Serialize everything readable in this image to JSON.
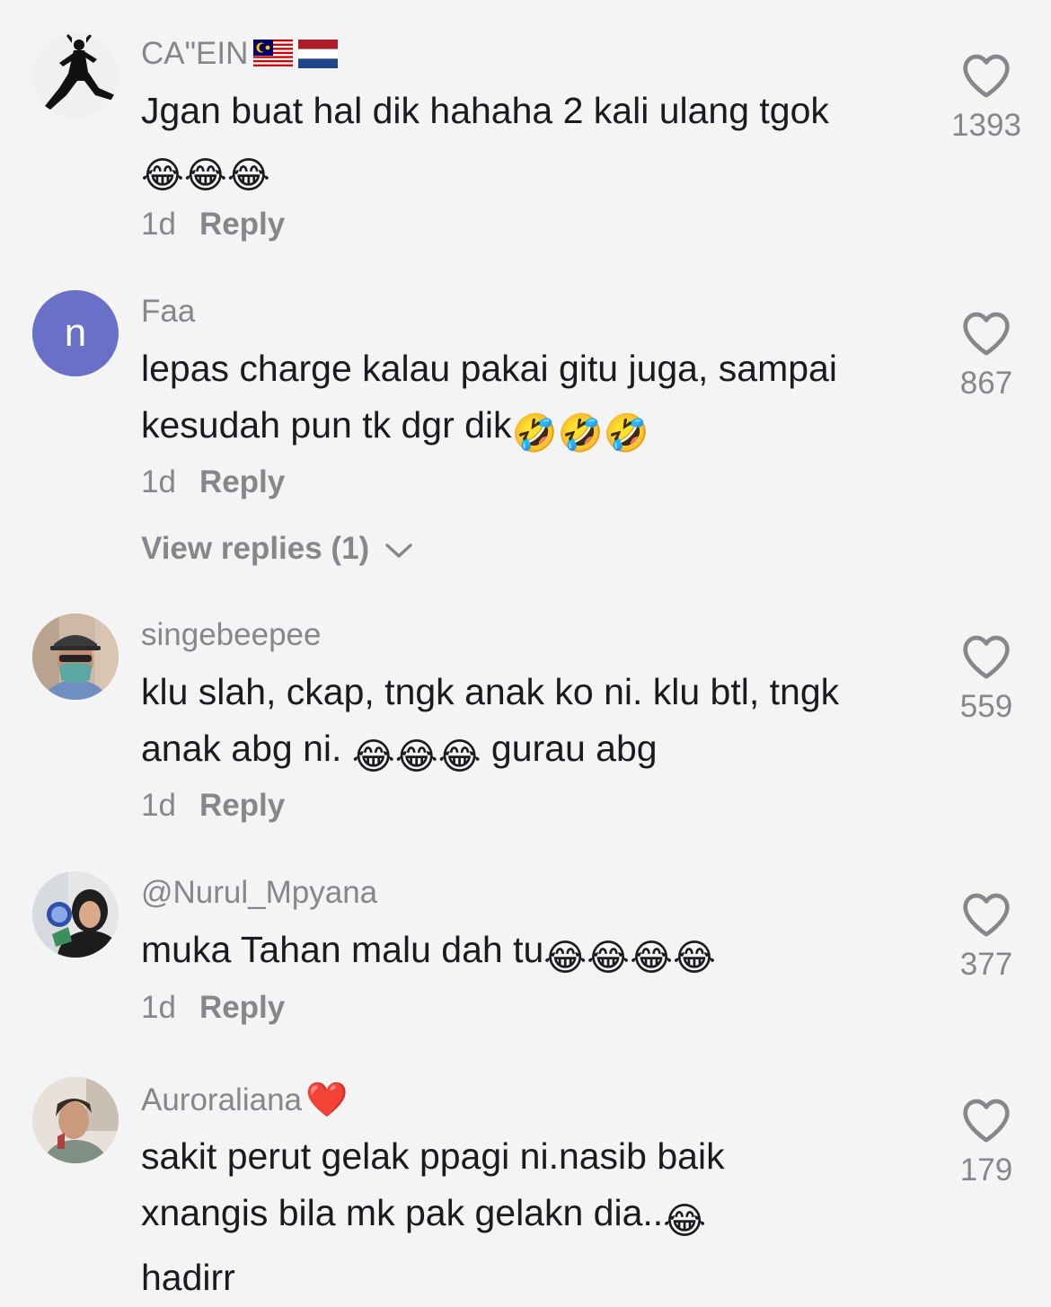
{
  "comments": [
    {
      "username": "CA\"EIN",
      "username_flags": [
        "malaysia-flag",
        "netherlands-flag"
      ],
      "text_lines": [
        "Jgan buat hal dik hahaha 2 kali ulang tgok",
        ""
      ],
      "emojis": "😂😂😂",
      "time": "1d",
      "reply_label": "Reply",
      "likes": "1393",
      "avatar": "silhouette-figure"
    },
    {
      "username": "Faa",
      "avatar_letter": "n",
      "text_lines": [
        "lepas charge kalau pakai gitu juga, sampai",
        "kesudah pun tk dgr dik"
      ],
      "emojis": "🤣🤣🤣",
      "time": "1d",
      "reply_label": "Reply",
      "likes": "867",
      "view_replies": "View replies (1)"
    },
    {
      "username": "singebeepee",
      "text_lines": [
        "klu slah, ckap, tngk anak ko ni. klu btl, tngk",
        "anak abg ni. "
      ],
      "emojis": "😂😂😂",
      "text_after_emojis": " gurau abg",
      "time": "1d",
      "reply_label": "Reply",
      "likes": "559",
      "avatar": "man-with-cap-and-mask"
    },
    {
      "username": "@Nurul_Mpyana",
      "text_lines": [
        "muka Tahan malu dah tu"
      ],
      "emojis": "😂😂😂😂",
      "time": "1d",
      "reply_label": "Reply",
      "likes": "377",
      "avatar": "woman-with-hijab-and-balloon"
    },
    {
      "username": "Auroraliana",
      "username_emoji": "❤️",
      "text_lines": [
        "sakit perut gelak ppagi ni.nasib baik",
        "xnangis bila mk pak gelakn dia..",
        "hadirr"
      ],
      "emojis": "😂",
      "likes": "179",
      "avatar": "woman-portrait"
    }
  ],
  "icons": {
    "like": "heart-outline-icon",
    "expand": "chevron-down-icon"
  },
  "colors": {
    "background": "#f4f4f5",
    "text": "#1b1b1d",
    "muted": "#86868b",
    "avatar_letter_bg": "#6870c8"
  }
}
